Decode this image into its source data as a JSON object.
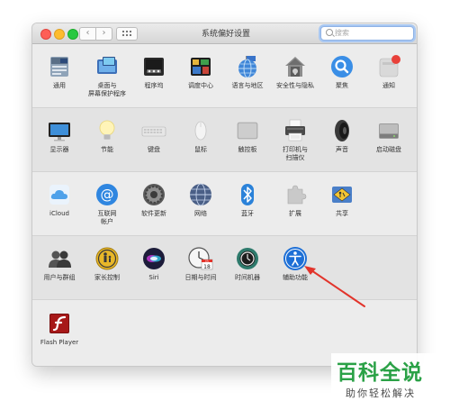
{
  "window": {
    "title": "系统偏好设置"
  },
  "toolbar": {
    "back_icon": "‹",
    "forward_icon": "›",
    "search_placeholder": "搜索"
  },
  "rows": [
    {
      "items": [
        {
          "name": "general",
          "label": [
            "通用"
          ],
          "icon": "general-icon"
        },
        {
          "name": "desktop-screensaver",
          "label": [
            "桌面与",
            "屏幕保护程序"
          ],
          "icon": "desktop-icon"
        },
        {
          "name": "dock",
          "label": [
            "程序坞"
          ],
          "icon": "dock-icon"
        },
        {
          "name": "mission-control",
          "label": [
            "调度中心"
          ],
          "icon": "mission-control-icon"
        },
        {
          "name": "language-region",
          "label": [
            "语言与地区"
          ],
          "icon": "globe-flag-icon"
        },
        {
          "name": "security-privacy",
          "label": [
            "安全性与隐私"
          ],
          "icon": "house-lock-icon"
        },
        {
          "name": "spotlight",
          "label": [
            "聚焦"
          ],
          "icon": "spotlight-icon"
        },
        {
          "name": "notifications",
          "label": [
            "通知"
          ],
          "icon": "notifications-icon"
        }
      ]
    },
    {
      "items": [
        {
          "name": "displays",
          "label": [
            "显示器"
          ],
          "icon": "display-icon"
        },
        {
          "name": "energy-saver",
          "label": [
            "节能"
          ],
          "icon": "lightbulb-icon"
        },
        {
          "name": "keyboard",
          "label": [
            "键盘"
          ],
          "icon": "keyboard-icon"
        },
        {
          "name": "mouse",
          "label": [
            "鼠标"
          ],
          "icon": "mouse-icon"
        },
        {
          "name": "trackpad",
          "label": [
            "触控板"
          ],
          "icon": "trackpad-icon"
        },
        {
          "name": "printers-scanners",
          "label": [
            "打印机与",
            "扫描仪"
          ],
          "icon": "printer-icon"
        },
        {
          "name": "sound",
          "label": [
            "声音"
          ],
          "icon": "speaker-icon"
        },
        {
          "name": "startup-disk",
          "label": [
            "启动磁盘"
          ],
          "icon": "disk-icon"
        }
      ]
    },
    {
      "items": [
        {
          "name": "icloud",
          "label": [
            "iCloud"
          ],
          "icon": "cloud-icon"
        },
        {
          "name": "internet-accounts",
          "label": [
            "互联网",
            "帐户"
          ],
          "icon": "at-sign-icon"
        },
        {
          "name": "software-update",
          "label": [
            "软件更新"
          ],
          "icon": "gear-icon"
        },
        {
          "name": "network",
          "label": [
            "网络"
          ],
          "icon": "network-globe-icon"
        },
        {
          "name": "bluetooth",
          "label": [
            "蓝牙"
          ],
          "icon": "bluetooth-icon"
        },
        {
          "name": "extensions",
          "label": [
            "扩展"
          ],
          "icon": "puzzle-icon"
        },
        {
          "name": "sharing",
          "label": [
            "共享"
          ],
          "icon": "sharing-sign-icon"
        }
      ]
    },
    {
      "items": [
        {
          "name": "users-groups",
          "label": [
            "用户与群组"
          ],
          "icon": "users-icon"
        },
        {
          "name": "parental-controls",
          "label": [
            "家长控制"
          ],
          "icon": "parental-icon"
        },
        {
          "name": "siri",
          "label": [
            "Siri"
          ],
          "icon": "siri-icon"
        },
        {
          "name": "date-time",
          "label": [
            "日期与时间"
          ],
          "icon": "clock-calendar-icon"
        },
        {
          "name": "time-machine",
          "label": [
            "时间机器"
          ],
          "icon": "time-machine-icon"
        },
        {
          "name": "accessibility",
          "label": [
            "辅助功能"
          ],
          "icon": "accessibility-icon"
        }
      ]
    },
    {
      "items": [
        {
          "name": "flash-player",
          "label": [
            "Flash Player"
          ],
          "icon": "flash-icon"
        }
      ]
    }
  ],
  "calendar": {
    "month": "JUL",
    "day": "18"
  },
  "watermark": {
    "title": "百科全说",
    "subtitle": "助你轻松解决"
  },
  "colors": {
    "highlight_arrow": "#e2342b",
    "watermark_green": "#2aa146",
    "search_focus": "#a9c8f2"
  }
}
